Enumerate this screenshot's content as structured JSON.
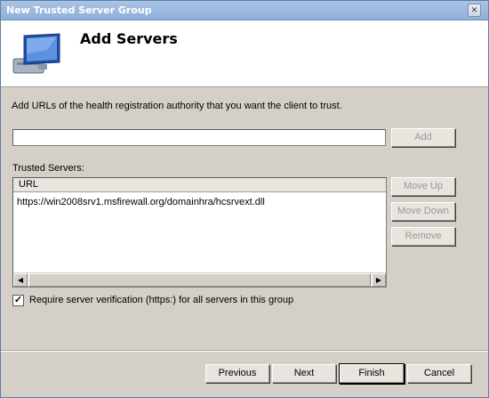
{
  "window": {
    "title": "New Trusted Server Group",
    "close_glyph": "✕"
  },
  "header": {
    "heading": "Add Servers",
    "icon": "computer-icon"
  },
  "description": "Add URLs of the health registration authority that you want the client to trust.",
  "url_input": {
    "value": "",
    "add_label": "Add"
  },
  "servers": {
    "label": "Trusted Servers:",
    "column_header": "URL",
    "rows": [
      "https://win2008srv1.msfirewall.org/domainhra/hcsrvext.dll"
    ],
    "move_up_label": "Move Up",
    "move_down_label": "Move Down",
    "remove_label": "Remove"
  },
  "verification": {
    "checked": true,
    "label": "Require server verification (https:) for all servers in this group",
    "mark": "✓"
  },
  "footer": {
    "previous_label": "Previous",
    "next_label": "Next",
    "finish_label": "Finish",
    "cancel_label": "Cancel"
  },
  "scroll": {
    "left_glyph": "◀",
    "right_glyph": "▶"
  }
}
